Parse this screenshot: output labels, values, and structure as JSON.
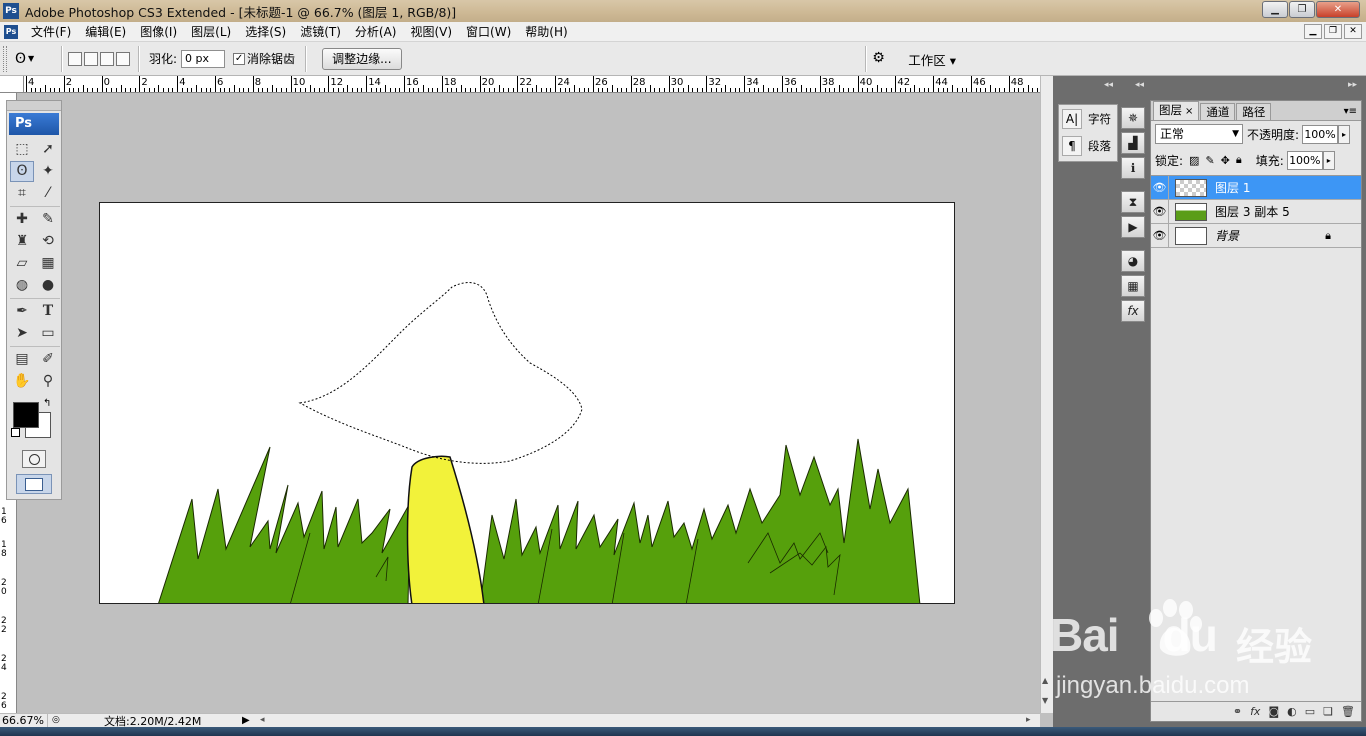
{
  "window": {
    "title": "Adobe Photoshop CS3 Extended - [未标题-1 @ 66.7% (图层 1, RGB/8)]",
    "app_icon": "Ps"
  },
  "menu": {
    "items": [
      "文件(F)",
      "编辑(E)",
      "图像(I)",
      "图层(L)",
      "选择(S)",
      "滤镜(T)",
      "分析(A)",
      "视图(V)",
      "窗口(W)",
      "帮助(H)"
    ]
  },
  "options": {
    "feather_label": "羽化:",
    "feather_value": "0 px",
    "antialias_label": "消除锯齿",
    "antialias_checked": true,
    "refine_edge_label": "调整边缘...",
    "workspace_label": "工作区 ▾"
  },
  "toolbox": {
    "header": "Ps",
    "foreground_color": "#000000",
    "background_color": "#ffffff"
  },
  "ruler": {
    "top_labels": [
      "4",
      "2",
      "0",
      "2",
      "4",
      "6",
      "8",
      "10",
      "12",
      "14",
      "16",
      "18",
      "20",
      "22",
      "24",
      "26",
      "28",
      "30",
      "32",
      "34",
      "36",
      "38",
      "40",
      "42",
      "44",
      "46",
      "48"
    ],
    "left_labels": [
      "1",
      "6",
      "1",
      "8",
      "2",
      "0",
      "2",
      "2",
      "2",
      "4",
      "2",
      "6"
    ]
  },
  "status": {
    "zoom": "66.67%",
    "doc_info": "文档:2.20M/2.42M"
  },
  "char_panel": {
    "character_label": "字符",
    "paragraph_label": "段落"
  },
  "layers_panel": {
    "tabs": [
      "图层",
      "通道",
      "路径"
    ],
    "blend_mode": "正常",
    "opacity_label": "不透明度:",
    "opacity_value": "100%",
    "lock_label": "锁定:",
    "fill_label": "填充:",
    "fill_value": "100%",
    "layers": [
      {
        "name": "图层 1",
        "selected": true
      },
      {
        "name": "图层 3 副本 5",
        "selected": false
      },
      {
        "name": "背景",
        "selected": false,
        "locked": true
      }
    ]
  },
  "watermark": {
    "brand": "Bai",
    "brand2": "du",
    "cn": "经验",
    "url": "jingyan.baidu.com"
  },
  "colors": {
    "grass": "#56a00c",
    "mushroom_stem": "#f2f23a",
    "canvas_bg": "#ffffff",
    "workspace_bg": "#c0c0c0",
    "selected_layer": "#3d96f5"
  }
}
